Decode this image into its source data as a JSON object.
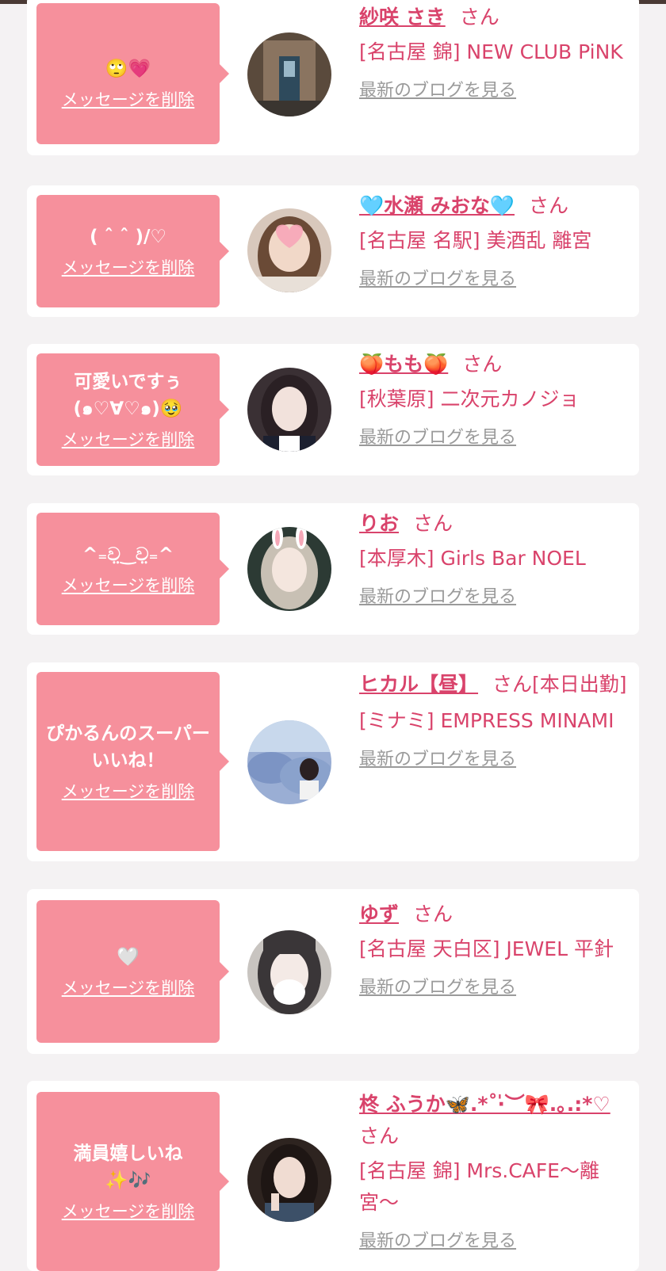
{
  "delete_label": "メッセージを削除",
  "blog_label": "最新のブログを見る",
  "san_label": "さん",
  "items": [
    {
      "message": "🙄💗",
      "name": "紗咲 さき",
      "san": "さん",
      "shop": "[名古屋 錦] NEW CLUB PiNK"
    },
    {
      "message": "( ˆ ˆ )/♡",
      "name": "🩵水瀬 みおな🩵",
      "san": "さん",
      "shop": "[名古屋 名駅] 美酒乱 離宮"
    },
    {
      "message": "可愛いですぅ(๑♡∀♡๑)🥹",
      "name": "🍑もも🍑",
      "san": "さん",
      "shop": "[秋葉原] 二次元カノジョ"
    },
    {
      "message": "^₌ව̤‿ව̤₌^",
      "name": "りお",
      "san": "さん",
      "shop": "[本厚木] Girls Bar NOEL"
    },
    {
      "message": "ぴかるんのスーパーいいね！",
      "name": "ヒカル【昼】",
      "san": "さん[本日出勤]",
      "shop": "[ミナミ] EMPRESS MINAMI"
    },
    {
      "message": "🤍",
      "name": "ゆず",
      "san": "さん",
      "shop": "[名古屋 天白区] JEWEL 平針"
    },
    {
      "message": "満員嬉しいね✨🎶",
      "name": "柊 ふうか🦋.*˚‧̍︎︶🎀.｡.:*♡",
      "san": "さん",
      "shop": "[名古屋 錦] Mrs.CAFE〜離宮〜"
    }
  ]
}
